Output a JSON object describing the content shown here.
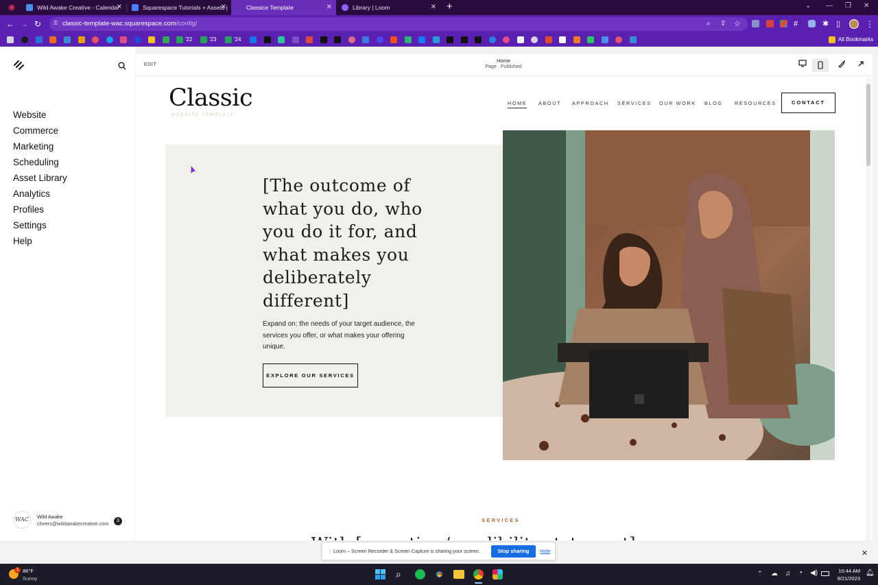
{
  "browser": {
    "tabs": [
      {
        "title": "Wild Awake Creative - Calendar",
        "favicon": "calendar-icon"
      },
      {
        "title": "Squarespace Tutorials + Assets |",
        "favicon": "docs-icon"
      },
      {
        "title": "Classice Template",
        "favicon": "squarespace-icon",
        "active": true
      },
      {
        "title": "Library | Loom",
        "favicon": "loom-icon"
      }
    ],
    "url_host": "classic-template-wac.squarespace.com",
    "url_path": "/config/",
    "bookmarks_label": "All Bookmarks",
    "bm_22": "'22",
    "bm_23": "'23",
    "bm_24": "'24"
  },
  "sidebar": {
    "items": [
      "Website",
      "Commerce",
      "Marketing",
      "Scheduling",
      "Asset Library",
      "Analytics",
      "Profiles",
      "Settings",
      "Help"
    ],
    "user_name": "Wild Awake",
    "user_email": "cheers@wildawakecreative.com",
    "notifications": "3",
    "avatar_text": "WAC"
  },
  "editor": {
    "edit_label": "EDIT",
    "page_name": "Home",
    "page_status": "Page · Published"
  },
  "site": {
    "logo": "Classic",
    "logo_sub": "WEBSITE TEMPLATE",
    "nav": [
      "HOME",
      "ABOUT",
      "APPROACH",
      "SERVICES",
      "OUR WORK",
      "BLOG",
      "RESOURCES"
    ],
    "contact": "CONTACT",
    "headline": "[The outcome of what you do, who you do it for, and what makes you deliberately different]",
    "body": "Expand on: the needs of your target audience, the services you offer, or what makes your offering unique.",
    "cta": "EXPLORE OUR SERVICES",
    "section_label": "SERVICES",
    "section_heading_partial": "With [expertise / credibility statement] we go beyond"
  },
  "loom": {
    "message": "Loom – Screen Recorder & Screen Capture is sharing your screen.",
    "stop": "Stop sharing",
    "hide": "Hide"
  },
  "taskbar": {
    "temp": "86°F",
    "condition": "Sunny",
    "weather_badge": "1",
    "time": "10:44 AM",
    "date": "9/21/2023"
  },
  "colors": {
    "tabbar": "#2a0b3f",
    "chrome_purple": "#5a21b0",
    "hero_bg": "#f1f0ea",
    "section_label": "#b0683a",
    "logo_sub": "#d8c8a8",
    "loom_button": "#1a6fe0"
  }
}
